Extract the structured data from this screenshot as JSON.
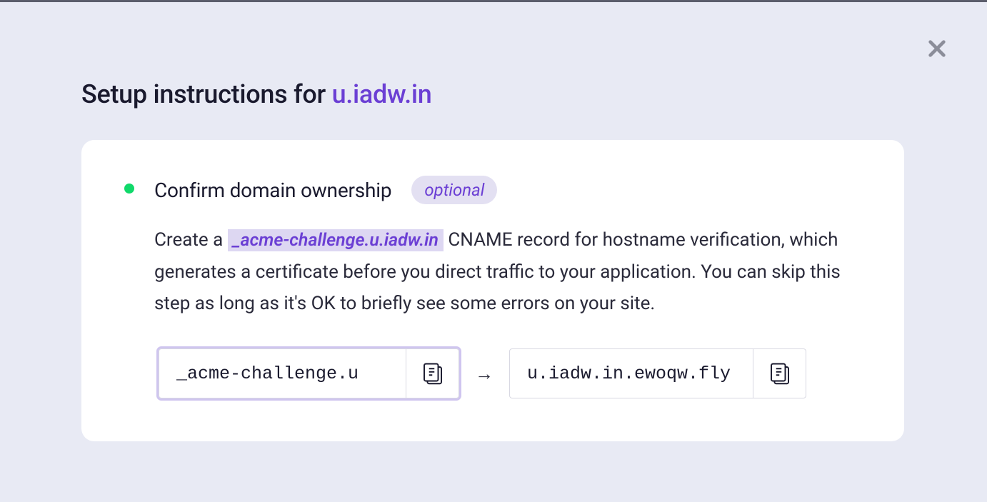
{
  "header": {
    "title_prefix": "Setup instructions for ",
    "domain": "u.iadw.in"
  },
  "step": {
    "title": "Confirm domain ownership",
    "badge": "optional",
    "description": {
      "pre": "Create a ",
      "code": "_acme-challenge.u.iadw.in",
      "post": " CNAME record for hostname verification, which generates a certificate before you direct traffic to your application. You can skip this step as long as it's OK to briefly see some errors on your site."
    },
    "dns": {
      "source": "_acme-challenge.u",
      "arrow": "→",
      "target": "u.iadw.in.ewoqw.fly"
    }
  }
}
